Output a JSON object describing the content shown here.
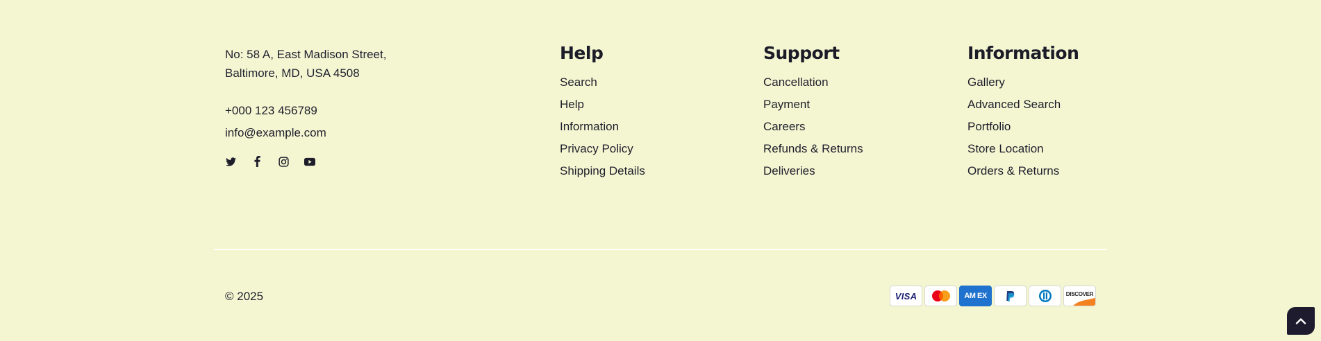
{
  "contact": {
    "address_line1": "No: 58 A, East Madison Street,",
    "address_line2": "Baltimore, MD, USA 4508",
    "phone": "+000 123 456789",
    "email": "info@example.com",
    "socials": [
      "twitter-icon",
      "facebook-icon",
      "instagram-icon",
      "youtube-icon"
    ]
  },
  "help": {
    "title": "Help",
    "links": [
      "Search",
      "Help",
      "Information",
      "Privacy Policy",
      "Shipping Details"
    ]
  },
  "support": {
    "title": "Support",
    "links": [
      "Cancellation",
      "Payment",
      "Careers",
      "Refunds & Returns",
      "Deliveries"
    ]
  },
  "information": {
    "title": "Information",
    "links": [
      "Gallery",
      "Advanced Search",
      "Portfolio",
      "Store Location",
      "Orders & Returns"
    ]
  },
  "bottom": {
    "copyright": "© 2025",
    "payment_methods": [
      {
        "name": "visa",
        "label": "VISA"
      },
      {
        "name": "mastercard",
        "label": ""
      },
      {
        "name": "amex",
        "label": "AM EX"
      },
      {
        "name": "paypal",
        "label": ""
      },
      {
        "name": "diners",
        "label": ""
      },
      {
        "name": "discover",
        "label": "DISCOVER"
      }
    ]
  },
  "colors": {
    "background": "#f4f6d2",
    "text": "#1e1e2a",
    "back_to_top": "#1e1b2e"
  },
  "back_to_top_icon": "chevron-up-icon"
}
